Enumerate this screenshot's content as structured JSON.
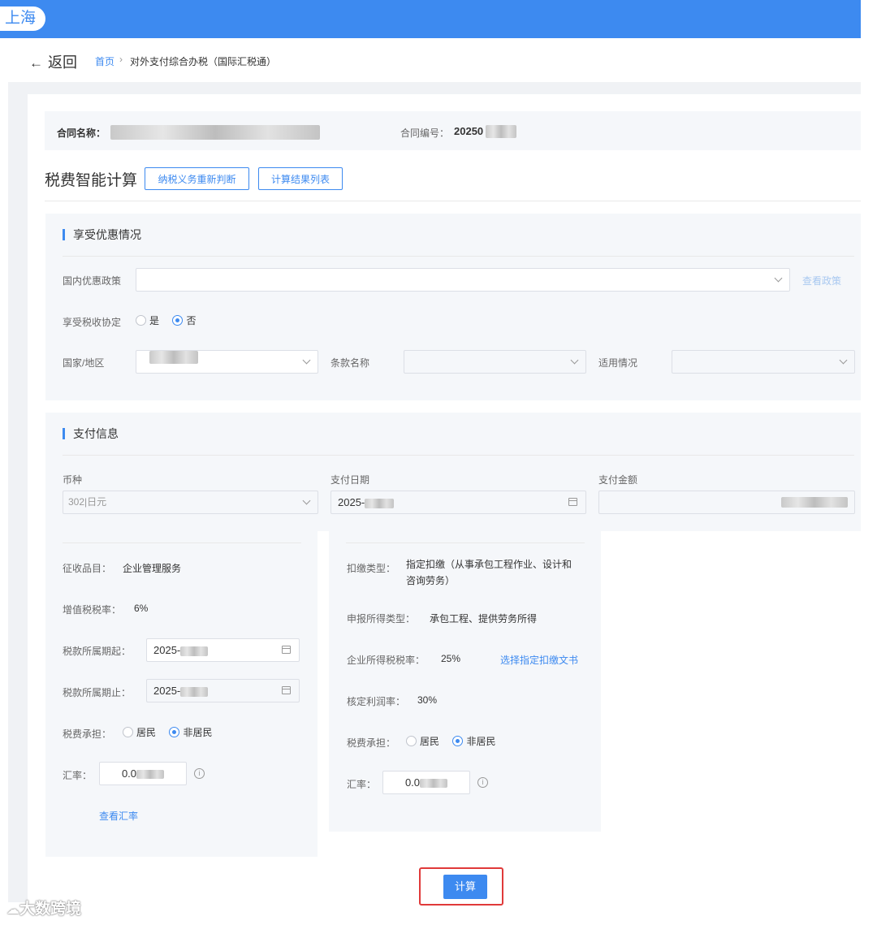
{
  "header": {
    "city": "上海"
  },
  "nav": {
    "back_label": "返回",
    "breadcrumb_home": "首页",
    "breadcrumb_sep": "›",
    "breadcrumb_current": "对外支付综合办税（国际汇税通）"
  },
  "contract": {
    "name_label": "合同名称：",
    "number_label": "合同编号：",
    "number_value": "20250"
  },
  "tax_calc": {
    "title": "税费智能计算",
    "rejudge_button": "纳税义务重新判断",
    "results_button": "计算结果列表"
  },
  "preferential": {
    "section_title": "享受优惠情况",
    "domestic_policy_label": "国内优惠政策",
    "view_policy_link": "查看政策",
    "treaty_label": "享受税收协定",
    "treaty_yes": "是",
    "treaty_no": "否",
    "treaty_selected": "否",
    "country_label": "国家/地区",
    "clause_label": "条款名称",
    "applicability_label": "适用情况"
  },
  "payment": {
    "section_title": "支付信息",
    "currency_label": "币种",
    "currency_value": "302|日元",
    "date_label": "支付日期",
    "date_value": "2025-",
    "amount_label": "支付金额"
  },
  "vat_panel": {
    "item_label": "征收品目：",
    "item_value": "企业管理服务",
    "rate_label": "增值税税率：",
    "rate_value": "6%",
    "period_start_label": "税款所属期起：",
    "period_start_value": "2025-",
    "period_end_label": "税款所属期止：",
    "period_end_value": "2025-",
    "bearer_label": "税费承担：",
    "bearer_resident": "居民",
    "bearer_nonresident": "非居民",
    "bearer_selected": "非居民",
    "fx_label": "汇率：",
    "fx_value": "0.0",
    "view_fx_link": "查看汇率"
  },
  "cit_panel": {
    "withholding_type_label": "扣缴类型：",
    "withholding_type_value_line1": "指定扣缴（从事承包工程作业、设计和",
    "withholding_type_value_line2": "咨询劳务）",
    "income_type_label": "申报所得类型：",
    "income_type_value": "承包工程、提供劳务所得",
    "cit_rate_label": "企业所得税税率：",
    "cit_rate_value": "25%",
    "designated_doc_link": "选择指定扣缴文书",
    "profit_rate_label": "核定利润率：",
    "profit_rate_value": "30%",
    "bearer_label": "税费承担：",
    "bearer_resident": "居民",
    "bearer_nonresident": "非居民",
    "bearer_selected": "非居民",
    "fx_label": "汇率：",
    "fx_value": "0.0"
  },
  "calculate_button": "计算",
  "watermark": "大数跨境"
}
